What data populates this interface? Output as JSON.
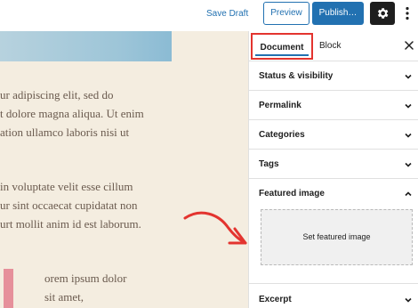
{
  "toolbar": {
    "save_draft": "Save Draft",
    "preview": "Preview",
    "publish": "Publish…"
  },
  "editor": {
    "paragraphs": [
      {
        "lines": [
          "ur adipiscing elit, sed do",
          "t dolore magna aliqua. Ut enim",
          "ation ullamco laboris nisi ut"
        ]
      },
      {
        "lines": [
          "in voluptate velit esse cillum",
          "ur sint occaecat cupidatat non",
          "urt mollit anim id est laborum."
        ]
      },
      {
        "lines": [
          "orem ipsum dolor",
          "sit amet,"
        ]
      }
    ]
  },
  "sidebar": {
    "tabs": {
      "document": "Document",
      "block": "Block"
    },
    "panels": {
      "status": "Status & visibility",
      "permalink": "Permalink",
      "categories": "Categories",
      "tags": "Tags",
      "featured": "Featured image",
      "excerpt": "Excerpt"
    },
    "set_featured_image": "Set featured image"
  },
  "colors": {
    "accent": "#2271b1",
    "highlight": "#e3342f",
    "editor_bg": "#f4ede0",
    "text_brown": "#6a5a4e"
  }
}
